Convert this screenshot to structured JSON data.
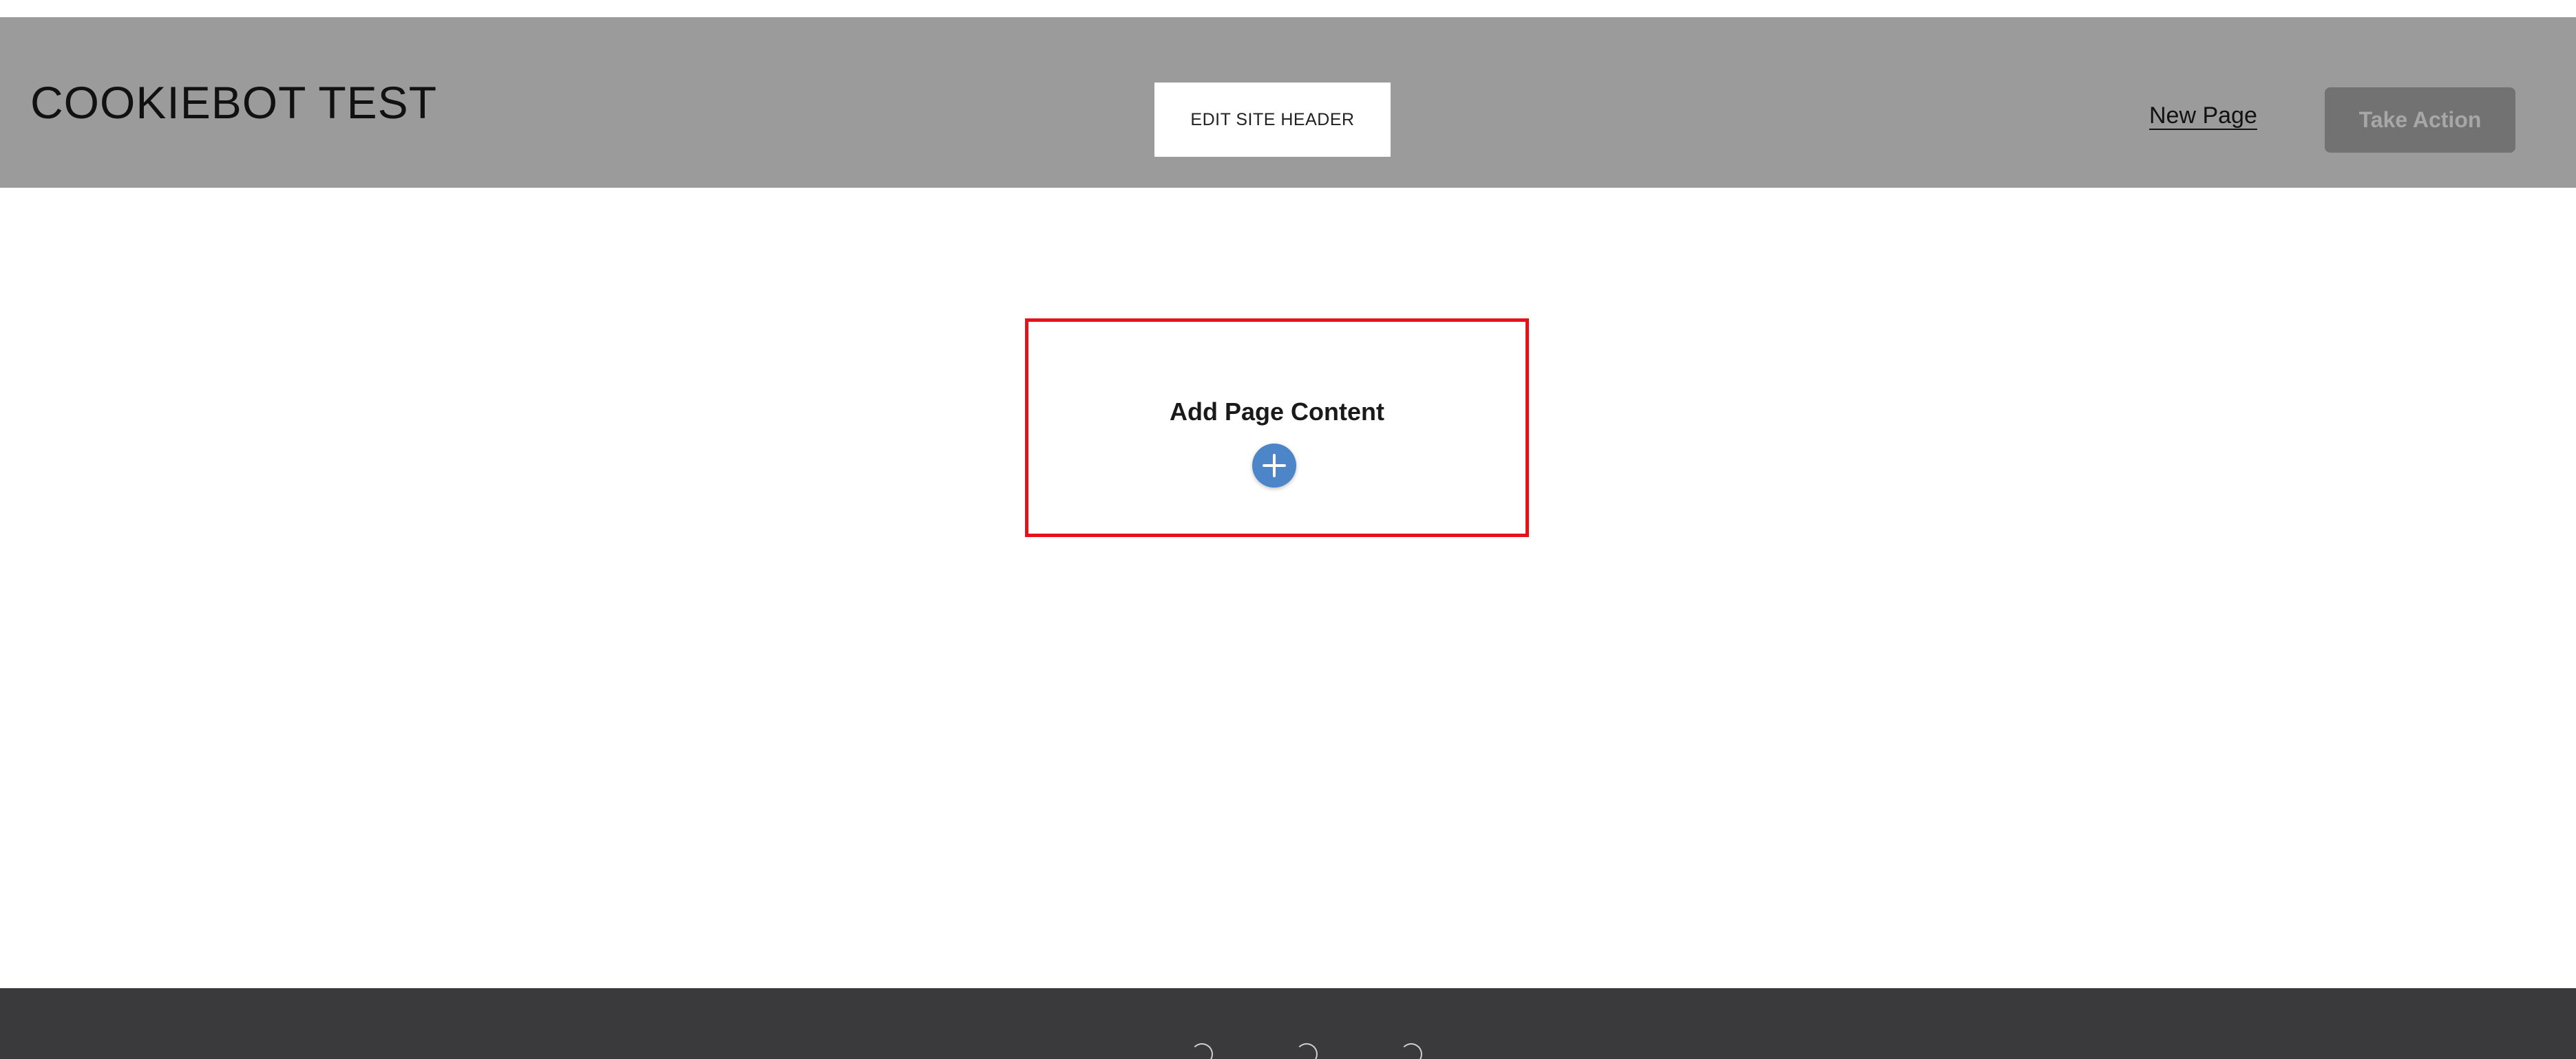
{
  "header": {
    "site_title": "COOKIEBOT TEST",
    "edit_button_label": "EDIT SITE HEADER",
    "nav_link_label": "New Page",
    "cta_label": "Take Action",
    "background_color": "#9b9b9b"
  },
  "main": {
    "add_content_label": "Add Page Content",
    "add_icon": "plus-icon",
    "highlight_color": "#e5121b",
    "add_button_color": "#4c85c8"
  },
  "footer": {
    "background_color": "#3a3a3c"
  }
}
